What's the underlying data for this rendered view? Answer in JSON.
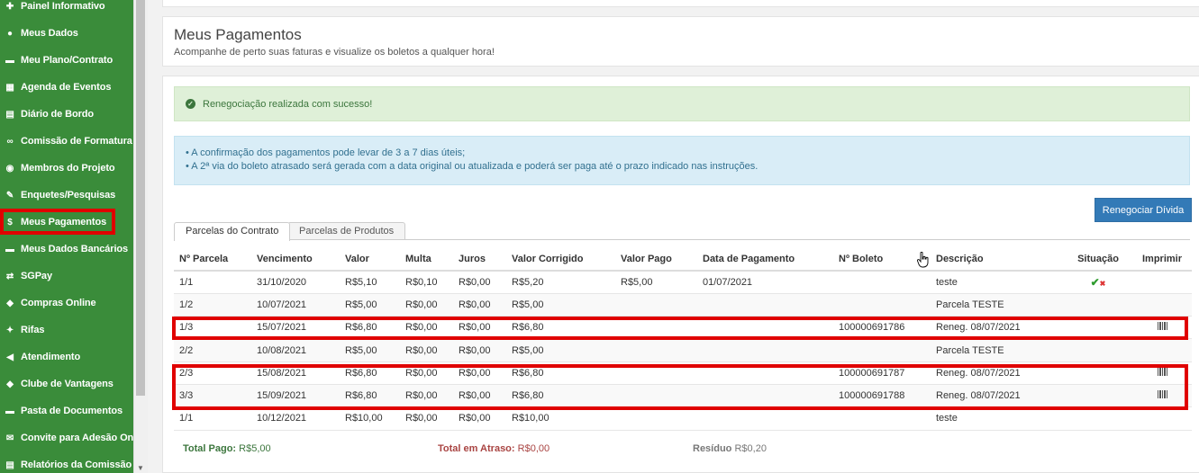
{
  "sidebar": {
    "items": [
      {
        "label": "Painel Informativo",
        "icon": "pin-icon",
        "glyph": "✚"
      },
      {
        "label": "Meus Dados",
        "icon": "user-icon",
        "glyph": "●"
      },
      {
        "label": "Meu Plano/Contrato",
        "icon": "folder-icon",
        "glyph": "▬"
      },
      {
        "label": "Agenda de Eventos",
        "icon": "calendar-icon",
        "glyph": "▦"
      },
      {
        "label": "Diário de Bordo",
        "icon": "book-icon",
        "glyph": "▤"
      },
      {
        "label": "Comissão de Formatura",
        "icon": "link-icon",
        "glyph": "∞"
      },
      {
        "label": "Membros do Projeto",
        "icon": "globe-icon",
        "glyph": "◉"
      },
      {
        "label": "Enquetes/Pesquisas",
        "icon": "edit-icon",
        "glyph": "✎"
      },
      {
        "label": "Meus Pagamentos",
        "icon": "dollar-icon",
        "glyph": "$"
      },
      {
        "label": "Meus Dados Bancários",
        "icon": "bank-icon",
        "glyph": "▬"
      },
      {
        "label": "SGPay",
        "icon": "exchange-icon",
        "glyph": "⇄"
      },
      {
        "label": "Compras Online",
        "icon": "cart-icon",
        "glyph": "◆"
      },
      {
        "label": "Rifas",
        "icon": "ticket-icon",
        "glyph": "✦"
      },
      {
        "label": "Atendimento",
        "icon": "megaphone-icon",
        "glyph": "◀"
      },
      {
        "label": "Clube de Vantagens",
        "icon": "tag-icon",
        "glyph": "◆"
      },
      {
        "label": "Pasta de Documentos",
        "icon": "folder-open-icon",
        "glyph": "▬"
      },
      {
        "label": "Convite para Adesão Online",
        "icon": "envelope-icon",
        "glyph": "✉"
      },
      {
        "label": "Relatórios da Comissão",
        "icon": "report-icon",
        "glyph": "▤"
      }
    ],
    "active": "Meus Pagamentos"
  },
  "header": {
    "title": "Meus Pagamentos",
    "subtitle": "Acompanhe de perto suas faturas e visualize os boletos a qualquer hora!"
  },
  "alerts": {
    "success": "Renegociação realizada com sucesso!",
    "info_lines": [
      "• A confirmação dos pagamentos pode levar de 3 a 7 dias úteis;",
      "• A 2ª via do boleto atrasado será gerada com a data original ou atualizada e poderá ser paga até o prazo indicado nas instruções."
    ]
  },
  "actions": {
    "renegotiate_label": "Renegociar Dívida"
  },
  "tabs": [
    {
      "label": "Parcelas do Contrato",
      "active": true
    },
    {
      "label": "Parcelas de Produtos",
      "active": false
    }
  ],
  "table": {
    "columns": [
      "Nº Parcela",
      "Vencimento",
      "Valor",
      "Multa",
      "Juros",
      "Valor Corrigido",
      "Valor Pago",
      "Data de Pagamento",
      "Nº Boleto",
      "Descrição",
      "Situação",
      "Imprimir"
    ],
    "rows": [
      {
        "parcela": "1/1",
        "vencimento": "31/10/2020",
        "valor": "R$5,10",
        "multa": "R$0,10",
        "juros": "R$0,00",
        "corrigido": "R$5,20",
        "pago": "R$5,00",
        "data_pagamento": "01/07/2021",
        "boleto": "",
        "descricao": "teste",
        "situacao": "paid-check-icon",
        "imprimir": ""
      },
      {
        "parcela": "1/2",
        "vencimento": "10/07/2021",
        "valor": "R$5,00",
        "multa": "R$0,00",
        "juros": "R$0,00",
        "corrigido": "R$5,00",
        "pago": "",
        "data_pagamento": "",
        "boleto": "",
        "descricao": "Parcela TESTE",
        "situacao": "",
        "imprimir": ""
      },
      {
        "parcela": "1/3",
        "vencimento": "15/07/2021",
        "valor": "R$6,80",
        "multa": "R$0,00",
        "juros": "R$0,00",
        "corrigido": "R$6,80",
        "pago": "",
        "data_pagamento": "",
        "boleto": "100000691786",
        "descricao": "Reneg. 08/07/2021",
        "situacao": "",
        "imprimir": "barcode-icon"
      },
      {
        "parcela": "2/2",
        "vencimento": "10/08/2021",
        "valor": "R$5,00",
        "multa": "R$0,00",
        "juros": "R$0,00",
        "corrigido": "R$5,00",
        "pago": "",
        "data_pagamento": "",
        "boleto": "",
        "descricao": "Parcela TESTE",
        "situacao": "",
        "imprimir": ""
      },
      {
        "parcela": "2/3",
        "vencimento": "15/08/2021",
        "valor": "R$6,80",
        "multa": "R$0,00",
        "juros": "R$0,00",
        "corrigido": "R$6,80",
        "pago": "",
        "data_pagamento": "",
        "boleto": "100000691787",
        "descricao": "Reneg. 08/07/2021",
        "situacao": "",
        "imprimir": "barcode-icon"
      },
      {
        "parcela": "3/3",
        "vencimento": "15/09/2021",
        "valor": "R$6,80",
        "multa": "R$0,00",
        "juros": "R$0,00",
        "corrigido": "R$6,80",
        "pago": "",
        "data_pagamento": "",
        "boleto": "100000691788",
        "descricao": "Reneg. 08/07/2021",
        "situacao": "",
        "imprimir": "barcode-icon"
      },
      {
        "parcela": "1/1",
        "vencimento": "10/12/2021",
        "valor": "R$10,00",
        "multa": "R$0,00",
        "juros": "R$0,00",
        "corrigido": "R$10,00",
        "pago": "",
        "data_pagamento": "",
        "boleto": "",
        "descricao": "teste",
        "situacao": "",
        "imprimir": ""
      }
    ]
  },
  "totals": {
    "paid_label": "Total Pago:",
    "paid_value": "R$5,00",
    "late_label": "Total em Atraso:",
    "late_value": "R$0,00",
    "residue_label": "Resíduo",
    "residue_value": "R$0,20"
  },
  "colors": {
    "sidebar_bg": "#3a8c3a",
    "highlight": "#e00000",
    "primary_button": "#337ab7",
    "success_bg": "#dff0d8",
    "info_bg": "#d9edf7"
  }
}
